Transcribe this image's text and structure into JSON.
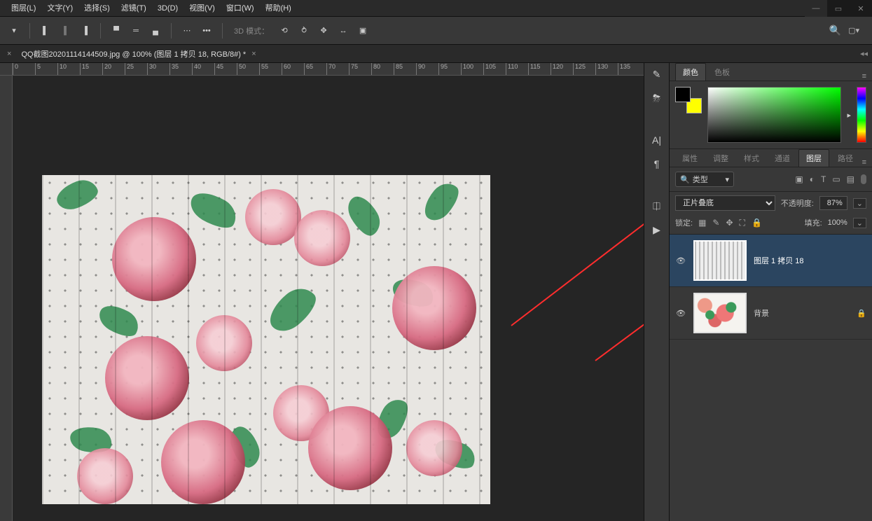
{
  "menu": {
    "items": [
      "图层(L)",
      "文字(Y)",
      "选择(S)",
      "滤镜(T)",
      "3D(D)",
      "视图(V)",
      "窗口(W)",
      "帮助(H)"
    ]
  },
  "options": {
    "label_3d_mode": "3D 模式："
  },
  "doctab": {
    "title": "QQ截图20201114144509.jpg @ 100% (图层 1 拷贝 18, RGB/8#) *"
  },
  "ruler": {
    "ticks": [
      "0",
      "5",
      "10",
      "15",
      "20",
      "25",
      "30",
      "35",
      "40",
      "45",
      "50",
      "55",
      "60",
      "65",
      "70",
      "75",
      "80",
      "85",
      "90",
      "95",
      "100",
      "105",
      "110",
      "115",
      "120",
      "125",
      "130",
      "135"
    ]
  },
  "panels": {
    "color": {
      "tab_a": "颜色",
      "tab_b": "色板"
    },
    "props": {
      "tabs": [
        "属性",
        "调整",
        "样式",
        "通道",
        "图层",
        "路径"
      ],
      "active_index": 4
    },
    "layers": {
      "search_label": "类型",
      "blend": {
        "label_mode": "",
        "mode": "正片叠底",
        "label_opacity": "不透明度:",
        "opacity": "87%"
      },
      "lock": {
        "label": "锁定:",
        "fill_label": "填充:",
        "fill": "100%"
      },
      "items": [
        {
          "name": "图层 1 拷贝 18",
          "locked": false,
          "active": true,
          "thumb": "stripes"
        },
        {
          "name": "背景",
          "locked": true,
          "active": false,
          "thumb": "flowers"
        }
      ]
    }
  }
}
